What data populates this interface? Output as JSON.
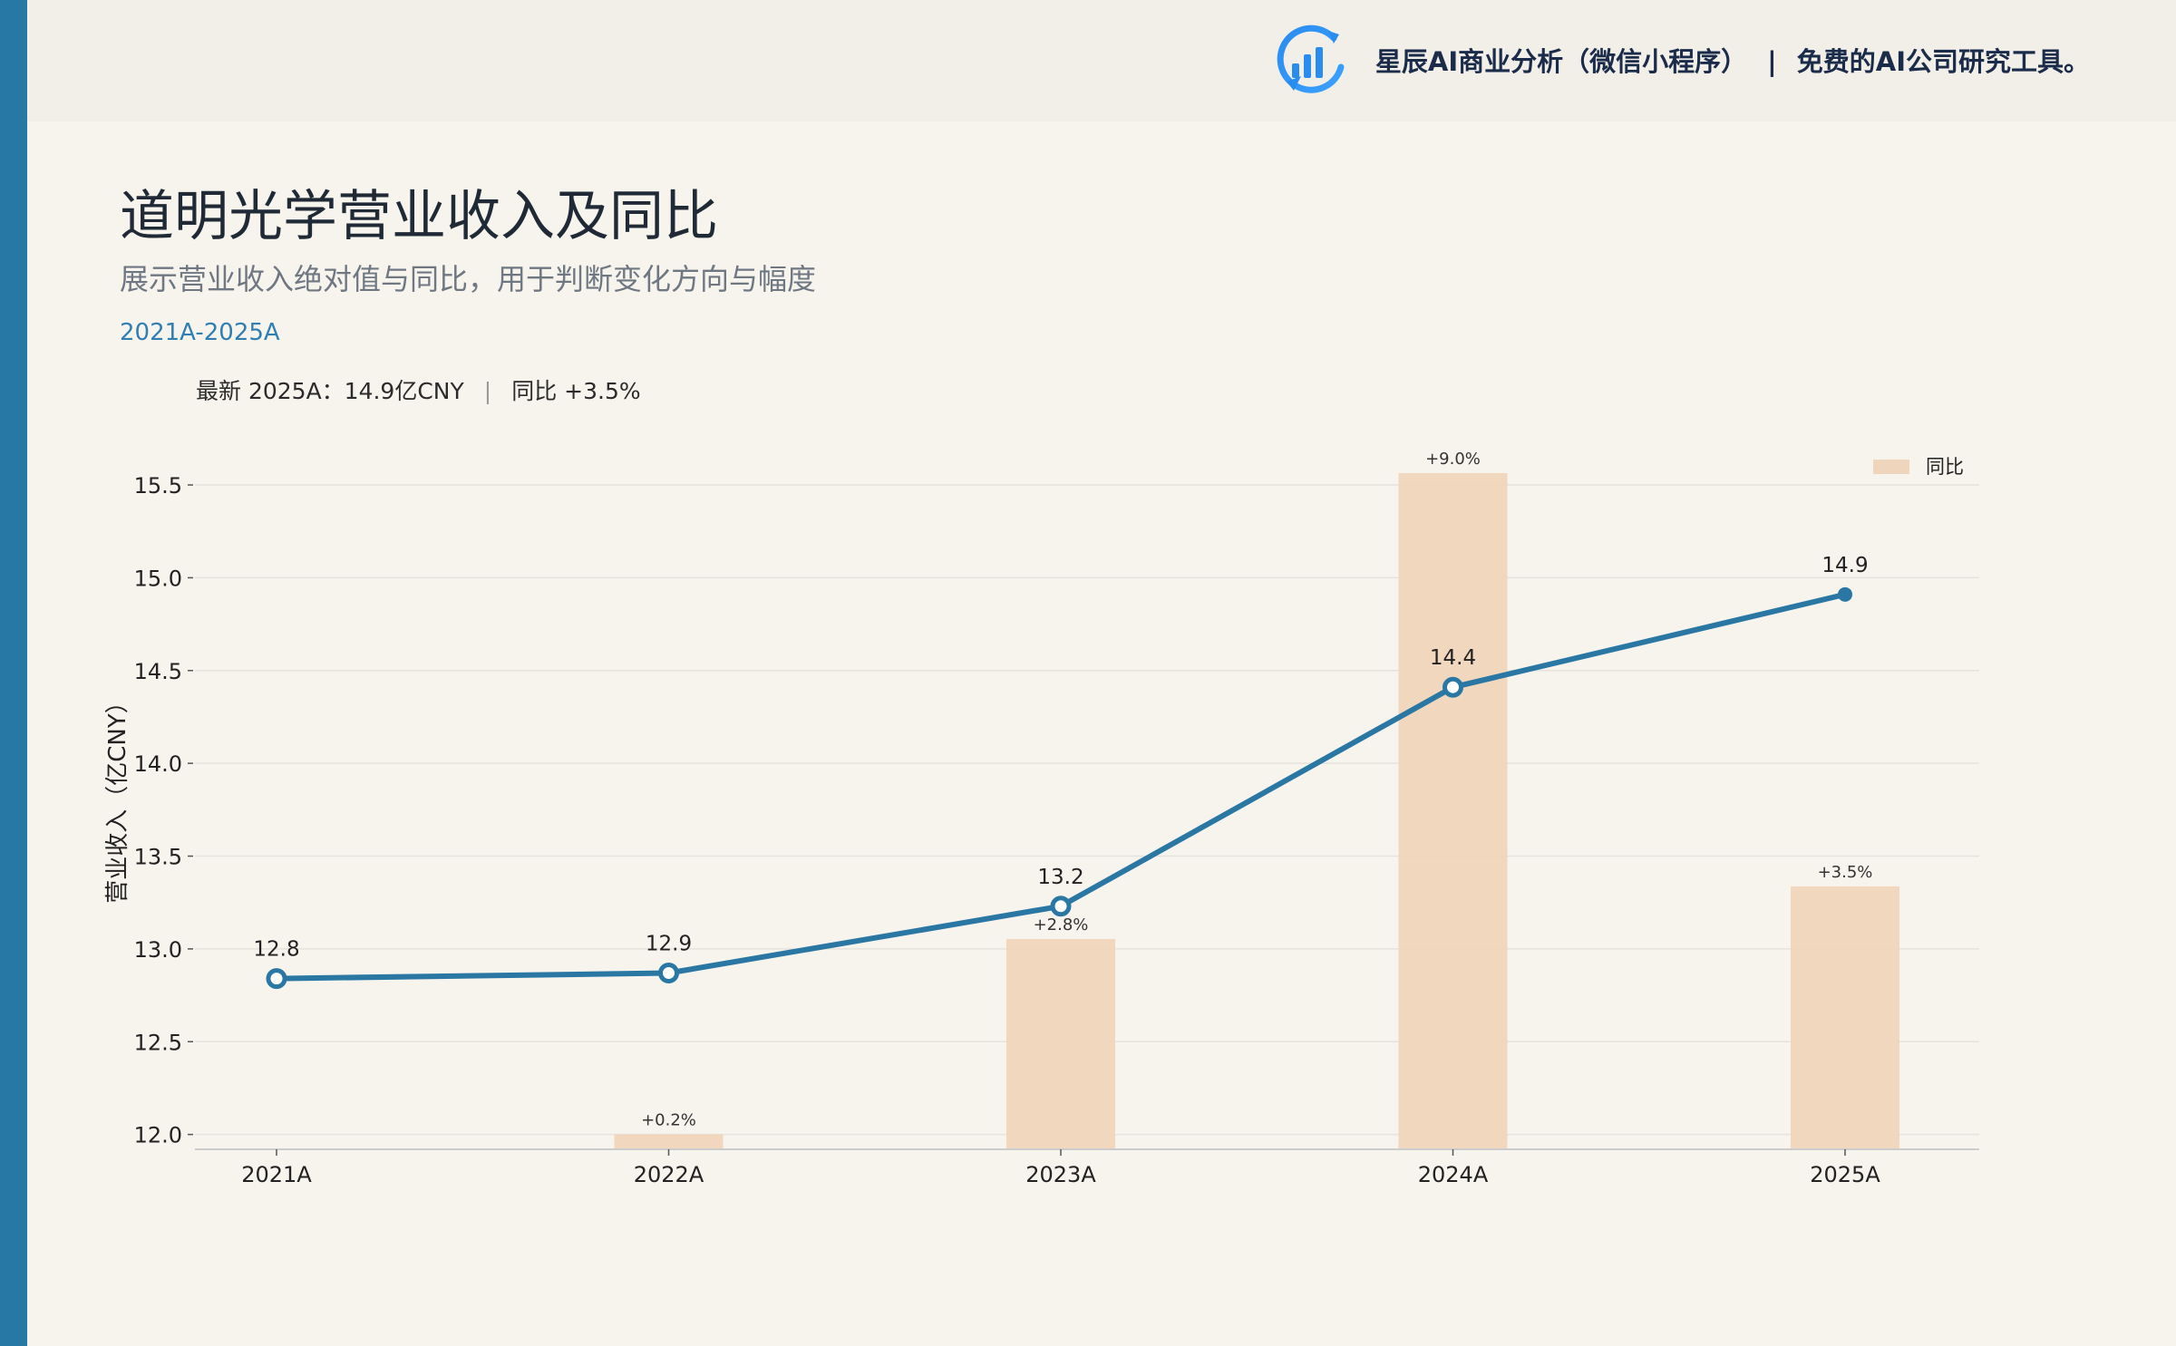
{
  "header": {
    "brand_name": "星辰AI商业分析（微信小程序）",
    "brand_separator": "|",
    "brand_slogan": "免费的AI公司研究工具。",
    "logo_icon": "bar-chart-refresh-icon"
  },
  "colors": {
    "accent": "#2878a6",
    "line": "#2a77a4",
    "bar": "#efd5bb",
    "background": "#f7f4ee"
  },
  "chart_data": {
    "type": "bar+line",
    "title": "道明光学营业收入及同比",
    "subtitle": "展示营业收入绝对值与同比，用于判断变化方向与幅度",
    "period": "2021A-2025A",
    "summary": {
      "latest_label": "最新 2025A：14.9亿CNY",
      "sep": "|",
      "yoy_label": "同比 +3.5%"
    },
    "categories": [
      "2021A",
      "2022A",
      "2023A",
      "2024A",
      "2025A"
    ],
    "revenue": {
      "values": [
        12.84,
        12.87,
        13.23,
        14.41,
        14.91
      ],
      "labels": [
        "12.8",
        "12.9",
        "13.2",
        "14.4",
        "14.9"
      ]
    },
    "yoy": {
      "name": "同比",
      "values": [
        null,
        0.2,
        2.8,
        9.0,
        3.5
      ],
      "labels": [
        "",
        "+0.2%",
        "+2.8%",
        "+9.0%",
        "+3.5%"
      ]
    },
    "ylabel": "营业收入（亿CNY）",
    "ylim": [
      11.92,
      15.72
    ],
    "yticks": [
      "12.0",
      "12.5",
      "13.0",
      "13.5",
      "14.0",
      "14.5",
      "15.0",
      "15.5"
    ],
    "legend_position": "top-right",
    "grid": true
  }
}
